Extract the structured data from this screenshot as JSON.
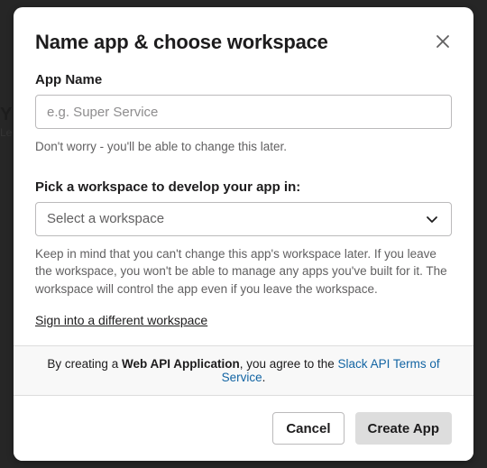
{
  "background": {
    "heading_tail": "Y",
    "sub_tail": "Le"
  },
  "modal": {
    "title": "Name app & choose workspace",
    "appName": {
      "label": "App Name",
      "placeholder": "e.g. Super Service",
      "help": "Don't worry - you'll be able to change this later."
    },
    "workspace": {
      "label": "Pick a workspace to develop your app in:",
      "selected": "Select a workspace",
      "help": "Keep in mind that you can't change this app's workspace later. If you leave the workspace, you won't be able to manage any apps you've built for it. The workspace will control the app even if you leave the workspace.",
      "signin_link": "Sign into a different workspace"
    },
    "terms": {
      "prefix": "By creating a ",
      "bold": "Web API Application",
      "middle": ", you agree to the ",
      "link": "Slack API Terms of Service",
      "suffix": "."
    },
    "buttons": {
      "cancel": "Cancel",
      "create": "Create App"
    }
  }
}
